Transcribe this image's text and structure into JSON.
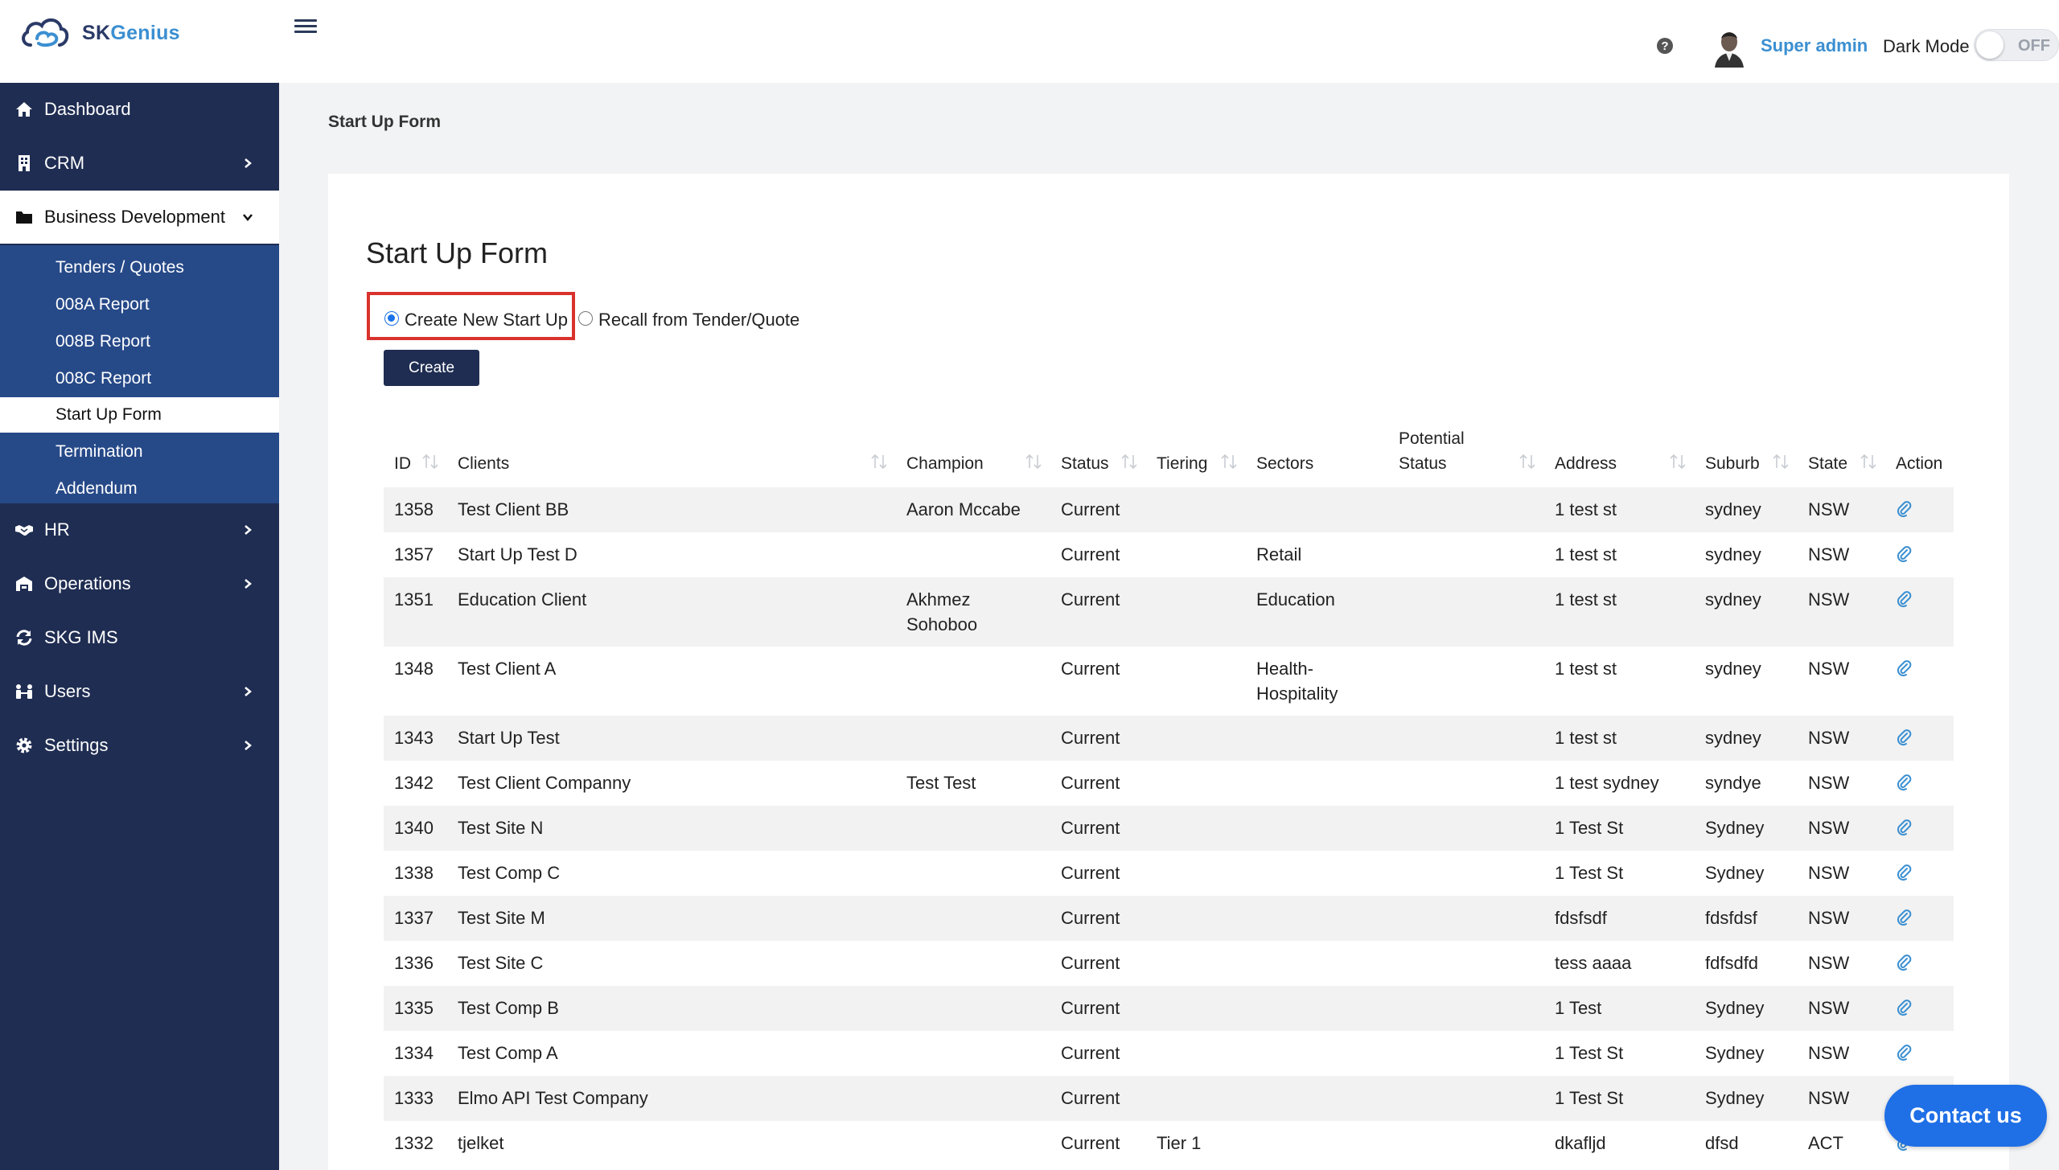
{
  "app": {
    "logo_sk": "SK",
    "logo_genius": "Genius"
  },
  "header": {
    "user_name": "Super admin",
    "dark_mode_label": "Dark Mode",
    "dark_mode_state": "OFF"
  },
  "sidebar": {
    "items": [
      {
        "label": "Dashboard",
        "icon": "home-icon"
      },
      {
        "label": "CRM",
        "icon": "building-icon"
      },
      {
        "label": "Business Development",
        "icon": "folder-icon"
      },
      {
        "label": "HR",
        "icon": "handshake-icon"
      },
      {
        "label": "Operations",
        "icon": "warehouse-icon"
      },
      {
        "label": "SKG IMS",
        "icon": "sync-icon"
      },
      {
        "label": "Users",
        "icon": "users-icon"
      },
      {
        "label": "Settings",
        "icon": "gear-icon"
      }
    ],
    "submenu": [
      "Tenders / Quotes",
      "008A Report",
      "008B Report",
      "008C Report",
      "Start Up Form",
      "Termination",
      "Addendum"
    ]
  },
  "breadcrumb": "Start Up Form",
  "main": {
    "title": "Start Up Form",
    "radio_new": "Create New Start Up",
    "radio_recall": "Recall from Tender/Quote",
    "create_label": "Create"
  },
  "table": {
    "headers": {
      "id": "ID",
      "clients": "Clients",
      "champion": "Champion",
      "status": "Status",
      "tiering": "Tiering",
      "sectors": "Sectors",
      "potential_1": "Potential",
      "potential_2": "Status",
      "address": "Address",
      "suburb": "Suburb",
      "state": "State",
      "action": "Action"
    },
    "rows": [
      {
        "id": "1358",
        "client": "Test Client BB",
        "champion": [
          "Aaron Mccabe"
        ],
        "status": "Current",
        "tiering": "",
        "sectors": [],
        "address": "1 test st",
        "suburb": "sydney",
        "state": "NSW"
      },
      {
        "id": "1357",
        "client": "Start Up Test D",
        "champion": [],
        "status": "Current",
        "tiering": "",
        "sectors": [
          "Retail"
        ],
        "address": "1 test st",
        "suburb": "sydney",
        "state": "NSW"
      },
      {
        "id": "1351",
        "client": "Education Client",
        "champion": [
          "Akhmez",
          "Sohoboo"
        ],
        "status": "Current",
        "tiering": "",
        "sectors": [
          "Education"
        ],
        "address": "1 test st",
        "suburb": "sydney",
        "state": "NSW"
      },
      {
        "id": "1348",
        "client": "Test Client A",
        "champion": [],
        "status": "Current",
        "tiering": "",
        "sectors": [
          "Health-",
          "Hospitality"
        ],
        "address": "1 test st",
        "suburb": "sydney",
        "state": "NSW"
      },
      {
        "id": "1343",
        "client": "Start Up Test",
        "champion": [],
        "status": "Current",
        "tiering": "",
        "sectors": [],
        "address": "1 test st",
        "suburb": "sydney",
        "state": "NSW"
      },
      {
        "id": "1342",
        "client": "Test Client Companny",
        "champion": [
          "Test Test"
        ],
        "status": "Current",
        "tiering": "",
        "sectors": [],
        "address": "1 test sydney",
        "suburb": "syndye",
        "state": "NSW"
      },
      {
        "id": "1340",
        "client": "Test Site N",
        "champion": [],
        "status": "Current",
        "tiering": "",
        "sectors": [],
        "address": "1 Test St",
        "suburb": "Sydney",
        "state": "NSW"
      },
      {
        "id": "1338",
        "client": "Test Comp C",
        "champion": [],
        "status": "Current",
        "tiering": "",
        "sectors": [],
        "address": "1 Test St",
        "suburb": "Sydney",
        "state": "NSW"
      },
      {
        "id": "1337",
        "client": "Test Site M",
        "champion": [],
        "status": "Current",
        "tiering": "",
        "sectors": [],
        "address": "fdsfsdf",
        "suburb": "fdsfdsf",
        "state": "NSW"
      },
      {
        "id": "1336",
        "client": "Test Site C",
        "champion": [],
        "status": "Current",
        "tiering": "",
        "sectors": [],
        "address": "tess aaaa",
        "suburb": "fdfsdfd",
        "state": "NSW"
      },
      {
        "id": "1335",
        "client": "Test Comp B",
        "champion": [],
        "status": "Current",
        "tiering": "",
        "sectors": [],
        "address": "1 Test",
        "suburb": "Sydney",
        "state": "NSW"
      },
      {
        "id": "1334",
        "client": "Test Comp A",
        "champion": [],
        "status": "Current",
        "tiering": "",
        "sectors": [],
        "address": "1 Test St",
        "suburb": "Sydney",
        "state": "NSW"
      },
      {
        "id": "1333",
        "client": "Elmo API Test Company",
        "champion": [],
        "status": "Current",
        "tiering": "",
        "sectors": [],
        "address": "1 Test St",
        "suburb": "Sydney",
        "state": "NSW"
      },
      {
        "id": "1332",
        "client": "tjelket",
        "champion": [],
        "status": "Current",
        "tiering": "Tier 1",
        "sectors": [],
        "address": "dkafljd",
        "suburb": "dfsd",
        "state": "ACT"
      }
    ]
  },
  "contact_label": "Contact us",
  "colors": {
    "sidebar": "#1f2d52",
    "submenu": "#264988",
    "accent": "#3b8fd1",
    "highlight": "#d9322d",
    "contact": "#1f6fe6"
  }
}
